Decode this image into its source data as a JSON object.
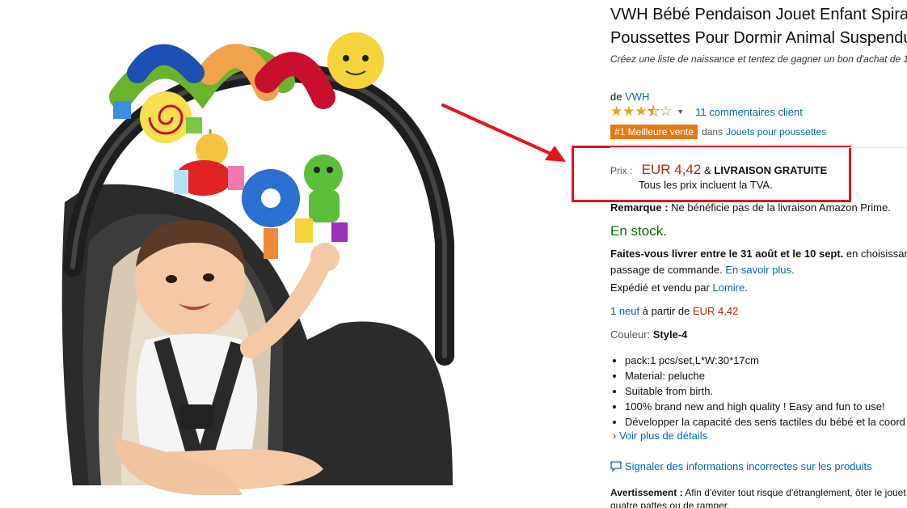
{
  "product": {
    "title_line1": "VWH Bébé Pendaison Jouet Enfant Spirale",
    "title_line2": "Poussettes Pour Dormir Animal Suspendu I",
    "promo": "Créez une liste de naissance et tentez de gagner un bon d'achat de 1",
    "brand_prefix": "de",
    "brand": "VWH",
    "rating": 3.5,
    "reviews_link": "11 commentaires client",
    "bestseller_badge": "#1 Meilleure vente",
    "category_prefix": "dans",
    "category": "Jouets pour poussettes"
  },
  "price": {
    "label": "Prix :",
    "amount": "EUR 4,42",
    "ampersand": "&",
    "shipping": "LIVRAISON GRATUITE",
    "vat_note": "Tous les prix incluent la TVA."
  },
  "remark": {
    "label": "Remarque :",
    "text": "Ne bénéficie pas de la livraison Amazon Prime."
  },
  "stock": "En stock.",
  "delivery": {
    "prefix": "Faites-vous livrer entre le",
    "bold": "31 août et le 10 sept.",
    "suffix": " en choisissan",
    "line2": "passage de commande.",
    "learn_more": "En savoir plus."
  },
  "seller": {
    "prefix": "Expédié et vendu par",
    "name": "Lomire",
    "period": "."
  },
  "offers": {
    "link": "1 neuf",
    "text": "à partir de",
    "price": "EUR 4,42"
  },
  "color": {
    "label": "Couleur:",
    "value": "Style-4"
  },
  "bullets": [
    "pack:1 pcs/set,L*W:30*17cm",
    "Material: peluche",
    "Suitable from birth.",
    "100% brand new and high quality ! Easy and fun to use!",
    "Développer la capacité des sens tactiles du bébé et la coord"
  ],
  "more_details": "Voir plus de détails",
  "report_link": "Signaler des informations incorrectes sur les produits",
  "warning": {
    "label": "Avertissement :",
    "line1": "Afin d'éviter tout risque d'étranglement, ôter le jouet",
    "line2": "quatre pattes ou de ramper."
  },
  "icons": {
    "star": "star-icon",
    "chevron": "chevron-down-icon",
    "comment": "comment-icon"
  },
  "colors": {
    "accent_link": "#0066c0",
    "price": "#b12704",
    "stock": "#007600",
    "badge": "#e47911",
    "annotation": "#e8141b"
  }
}
